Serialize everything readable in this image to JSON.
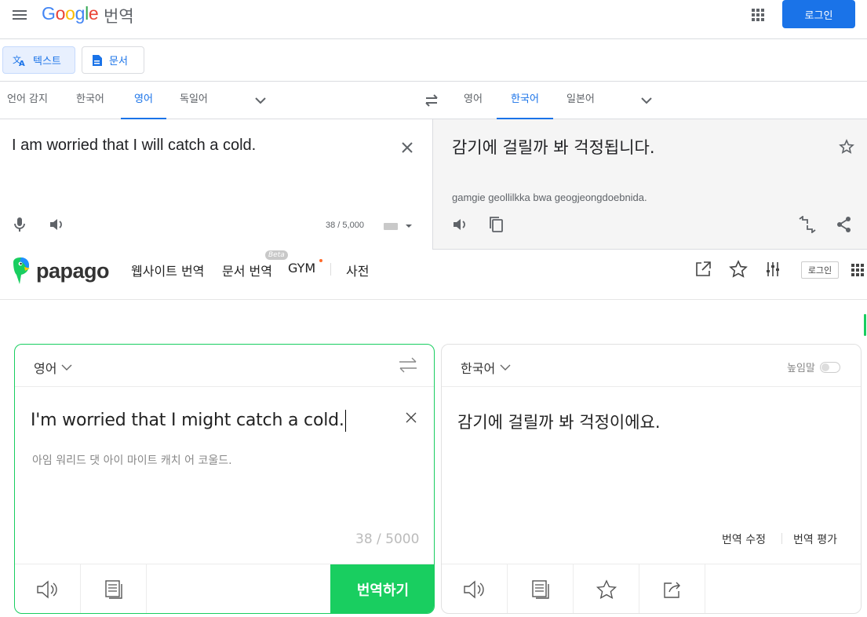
{
  "google": {
    "logo_letters": [
      "G",
      "o",
      "o",
      "g",
      "l",
      "e"
    ],
    "product": "번역",
    "login": "로그인",
    "modes": {
      "text": "텍스트",
      "document": "문서"
    },
    "source_langs": [
      "언어 감지",
      "한국어",
      "영어",
      "독일어"
    ],
    "source_active": "영어",
    "target_langs": [
      "영어",
      "한국어",
      "일본어"
    ],
    "target_active": "한국어",
    "source_text": "I am worried that I will catch a cold.",
    "char_count": "38 / 5,000",
    "translation": "감기에 걸릴까 봐 걱정됩니다.",
    "romanization": "gamgie geollilkka bwa geogjeongdoebnida.",
    "accent_color": "#1a73e8"
  },
  "papago": {
    "logo": "papago",
    "nav": {
      "website": "웹사이트 번역",
      "document": "문서 번역",
      "beta": "Beta",
      "gym": "GYM",
      "dictionary": "사전"
    },
    "login": "로그인",
    "source_lang": "영어",
    "target_lang": "한국어",
    "source_text": "I'm worried that I might catch a cold.",
    "source_pronunciation": "아임 워리드 댓 아이 마이트 캐치 어 코울드.",
    "char_count": "38 / 5000",
    "translate_button": "번역하기",
    "translation": "감기에 걸릴까 봐 걱정이에요.",
    "honorific": "높임말",
    "edit_translation": "번역 수정",
    "rate_translation": "번역 평가",
    "accent_color": "#19ce60"
  }
}
